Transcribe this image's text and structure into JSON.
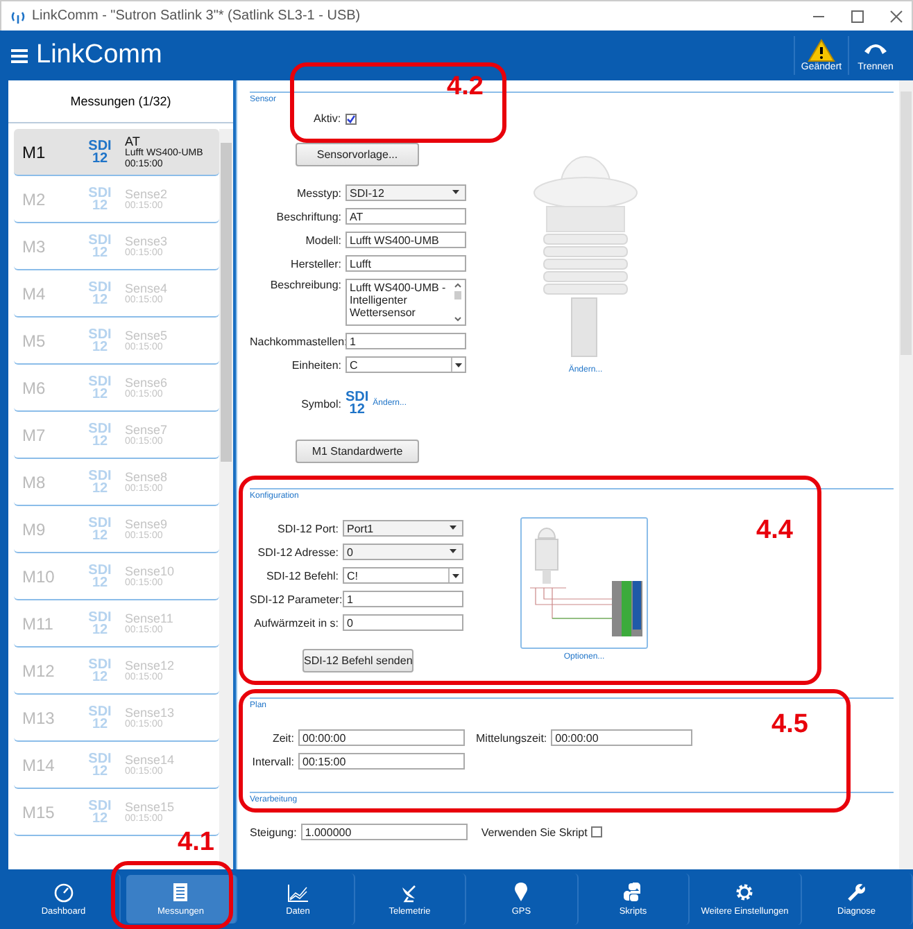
{
  "window": {
    "title": "LinkComm - \"Sutron Satlink 3\"* (Satlink SL3-1 - USB)"
  },
  "header": {
    "title": "LinkComm",
    "actions": [
      {
        "label": "Geändert",
        "kind": "warning"
      },
      {
        "label": "Trennen",
        "kind": "phone"
      }
    ]
  },
  "measurements": {
    "title": "Messungen (1/32)",
    "items": [
      {
        "id": "M1",
        "symbol": [
          "SDI",
          "12"
        ],
        "name": "AT",
        "model": "Lufft WS400-UMB",
        "interval": "00:15:00",
        "selected": true,
        "active": true
      },
      {
        "id": "M2",
        "symbol": [
          "SDI",
          "12"
        ],
        "name": "Sense2",
        "interval": "00:15:00",
        "selected": false,
        "active": false
      },
      {
        "id": "M3",
        "symbol": [
          "SDI",
          "12"
        ],
        "name": "Sense3",
        "interval": "00:15:00",
        "selected": false,
        "active": false
      },
      {
        "id": "M4",
        "symbol": [
          "SDI",
          "12"
        ],
        "name": "Sense4",
        "interval": "00:15:00",
        "selected": false,
        "active": false
      },
      {
        "id": "M5",
        "symbol": [
          "SDI",
          "12"
        ],
        "name": "Sense5",
        "interval": "00:15:00",
        "selected": false,
        "active": false
      },
      {
        "id": "M6",
        "symbol": [
          "SDI",
          "12"
        ],
        "name": "Sense6",
        "interval": "00:15:00",
        "selected": false,
        "active": false
      },
      {
        "id": "M7",
        "symbol": [
          "SDI",
          "12"
        ],
        "name": "Sense7",
        "interval": "00:15:00",
        "selected": false,
        "active": false
      },
      {
        "id": "M8",
        "symbol": [
          "SDI",
          "12"
        ],
        "name": "Sense8",
        "interval": "00:15:00",
        "selected": false,
        "active": false
      },
      {
        "id": "M9",
        "symbol": [
          "SDI",
          "12"
        ],
        "name": "Sense9",
        "interval": "00:15:00",
        "selected": false,
        "active": false
      },
      {
        "id": "M10",
        "symbol": [
          "SDI",
          "12"
        ],
        "name": "Sense10",
        "interval": "00:15:00",
        "selected": false,
        "active": false
      },
      {
        "id": "M11",
        "symbol": [
          "SDI",
          "12"
        ],
        "name": "Sense11",
        "interval": "00:15:00",
        "selected": false,
        "active": false
      },
      {
        "id": "M12",
        "symbol": [
          "SDI",
          "12"
        ],
        "name": "Sense12",
        "interval": "00:15:00",
        "selected": false,
        "active": false
      },
      {
        "id": "M13",
        "symbol": [
          "SDI",
          "12"
        ],
        "name": "Sense13",
        "interval": "00:15:00",
        "selected": false,
        "active": false
      },
      {
        "id": "M14",
        "symbol": [
          "SDI",
          "12"
        ],
        "name": "Sense14",
        "interval": "00:15:00",
        "selected": false,
        "active": false
      },
      {
        "id": "M15",
        "symbol": [
          "SDI",
          "12"
        ],
        "name": "Sense15",
        "interval": "00:15:00",
        "selected": false,
        "active": false
      }
    ]
  },
  "sensor": {
    "title": "Sensor",
    "active": {
      "label": "Aktiv:",
      "checked": true
    },
    "template_button": "Sensorvorlage...",
    "fields": [
      {
        "label": "Messtyp:",
        "value": "SDI-12",
        "kind": "select"
      },
      {
        "label": "Beschriftung:",
        "value": "AT",
        "kind": "text"
      },
      {
        "label": "Modell:",
        "value": "Lufft WS400-UMB",
        "kind": "text"
      },
      {
        "label": "Hersteller:",
        "value": "Lufft",
        "kind": "text"
      },
      {
        "label": "Beschreibung:",
        "value": "Lufft WS400-UMB - Intelligenter Wettersensor",
        "kind": "textarea"
      },
      {
        "label": "Nachkommastellen:",
        "value": "1",
        "kind": "text"
      },
      {
        "label": "Einheiten:",
        "value": "C",
        "kind": "combo"
      }
    ],
    "symbol": {
      "label": "Symbol:",
      "icon": [
        "SDI",
        "12"
      ],
      "link": "Ändern..."
    },
    "image_link": "Ändern...",
    "defaults_button": "M1 Standardwerte"
  },
  "configuration": {
    "title": "Konfiguration",
    "fields": [
      {
        "label": "SDI-12 Port:",
        "value": "Port1",
        "kind": "select"
      },
      {
        "label": "SDI-12 Adresse:",
        "value": "0",
        "kind": "select"
      },
      {
        "label": "SDI-12 Befehl:",
        "value": "C!",
        "kind": "combo"
      },
      {
        "label": "SDI-12 Parameter:",
        "value": "1",
        "kind": "text"
      },
      {
        "label": "Aufwärmzeit in s:",
        "value": "0",
        "kind": "text"
      }
    ],
    "send_button": "SDI-12 Befehl senden",
    "diagram_link": "Optionen..."
  },
  "plan": {
    "title": "Plan",
    "fields": [
      {
        "label": "Zeit:",
        "value": "00:00:00"
      },
      {
        "label": "Intervall:",
        "value": "00:15:00"
      }
    ],
    "side_field": {
      "label": "Mittelungszeit:",
      "value": "00:00:00"
    }
  },
  "processing": {
    "title": "Verarbeitung",
    "field": {
      "label": "Steigung:",
      "value": "1.000000"
    },
    "script": {
      "label": "Verwenden Sie Skript",
      "checked": false
    }
  },
  "nav": [
    {
      "label": "Dashboard",
      "kind": "gauge",
      "selected": false
    },
    {
      "label": "Messungen",
      "kind": "list",
      "selected": true
    },
    {
      "label": "Daten",
      "kind": "chart",
      "selected": false
    },
    {
      "label": "Telemetrie",
      "kind": "dish",
      "selected": false
    },
    {
      "label": "GPS",
      "kind": "pin",
      "selected": false
    },
    {
      "label": "Skripts",
      "kind": "python",
      "selected": false
    },
    {
      "label": "Weitere Einstellungen",
      "kind": "gear",
      "selected": false
    },
    {
      "label": "Diagnose",
      "kind": "wrench",
      "selected": false
    }
  ],
  "callouts": [
    {
      "label": "4.1"
    },
    {
      "label": "4.2"
    },
    {
      "label": "4.4"
    },
    {
      "label": "4.5"
    }
  ]
}
